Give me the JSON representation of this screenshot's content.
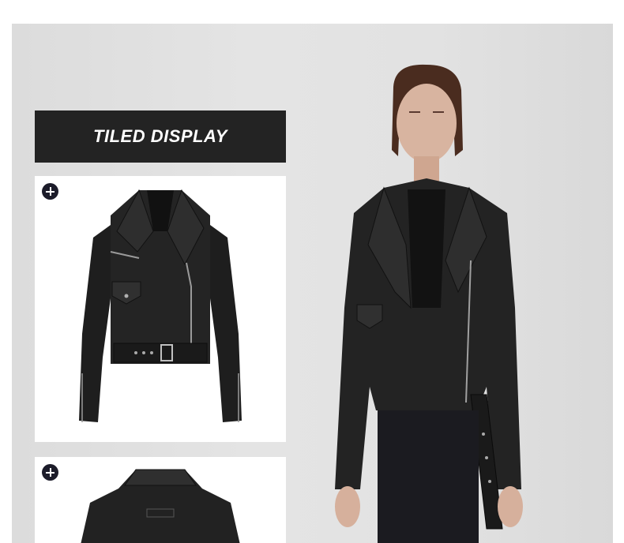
{
  "banner": {
    "title": "TILED DISPLAY"
  },
  "icons": {
    "expand": "plus-circle-icon"
  },
  "colors": {
    "banner_bg": "#232323",
    "panel_bg": "#e0e0e0",
    "plus_bg": "#1c1c2a"
  }
}
